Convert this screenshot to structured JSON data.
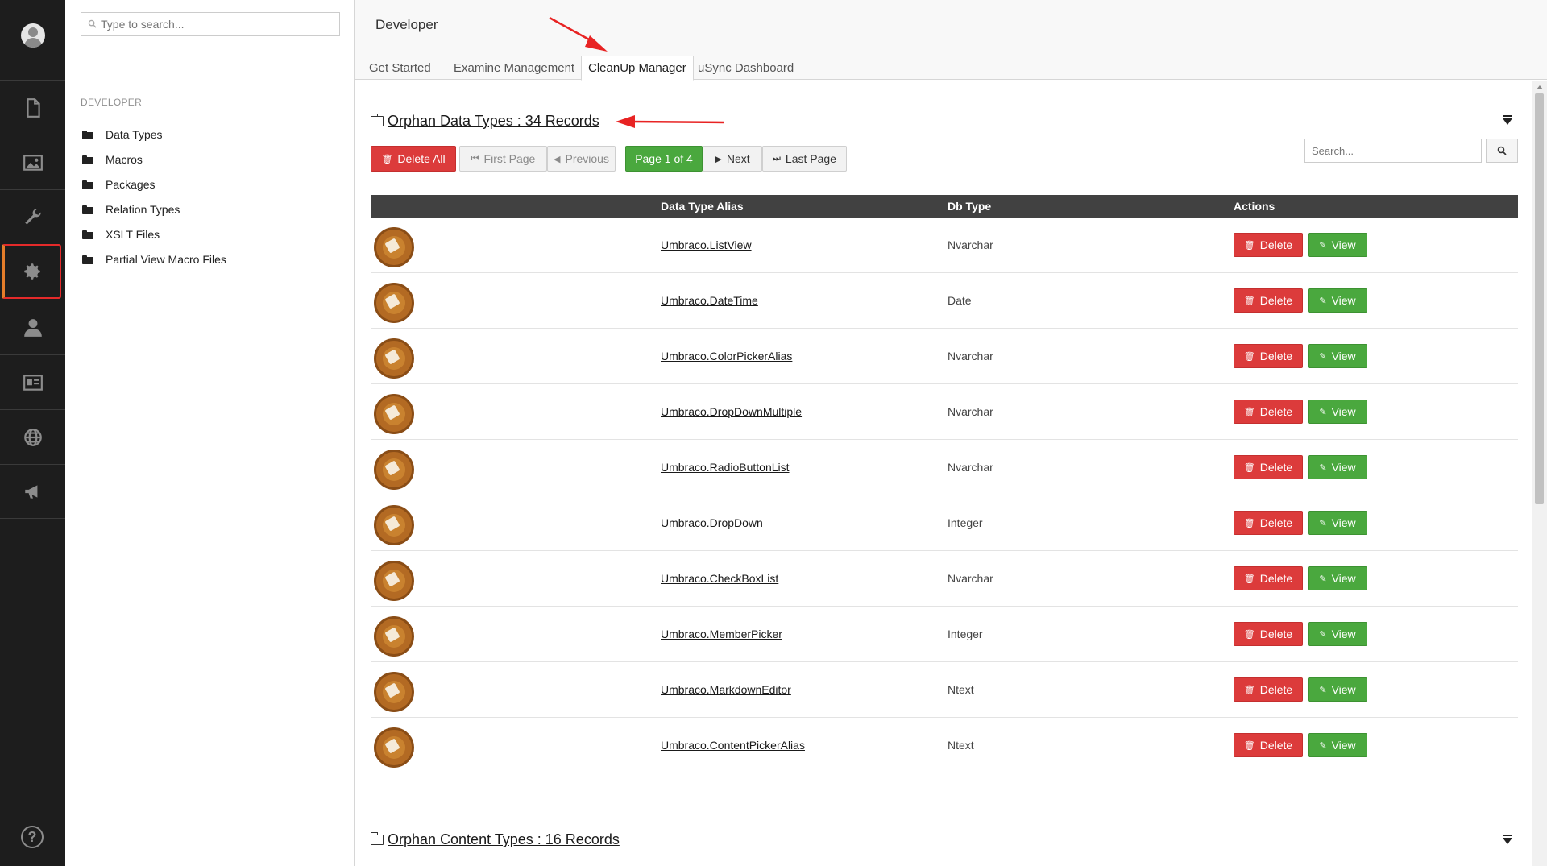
{
  "tree": {
    "search_placeholder": "Type to search...",
    "heading": "DEVELOPER",
    "items": [
      {
        "label": "Data Types"
      },
      {
        "label": "Macros"
      },
      {
        "label": "Packages"
      },
      {
        "label": "Relation Types"
      },
      {
        "label": "XSLT Files"
      },
      {
        "label": "Partial View Macro Files"
      }
    ]
  },
  "rail": {
    "icons": [
      "content-icon",
      "media-icon",
      "settings-wrench-icon",
      "developer-gear-icon",
      "users-icon",
      "members-icon",
      "translation-globe-icon",
      "forms-megaphone-icon"
    ],
    "active": "developer-gear-icon",
    "help": "?"
  },
  "header": {
    "title": "Developer",
    "tabs": [
      {
        "label": "Get Started",
        "active": false
      },
      {
        "label": "Examine Management",
        "active": false
      },
      {
        "label": "CleanUp Manager",
        "active": true
      },
      {
        "label": "uSync Dashboard",
        "active": false
      }
    ]
  },
  "orphan_data_types": {
    "title": "Orphan Data Types : 34 Records",
    "pager": {
      "delete_all": "Delete All",
      "first": "First Page",
      "previous": "Previous",
      "page": "Page 1 of 4",
      "next": "Next",
      "last": "Last Page"
    },
    "search_placeholder": "Search...",
    "columns": [
      "Data Type Alias",
      "Db Type",
      "Actions"
    ],
    "delete_label": "Delete",
    "view_label": "View",
    "rows": [
      {
        "alias": "Umbraco.ListView",
        "db_type": "Nvarchar"
      },
      {
        "alias": "Umbraco.DateTime",
        "db_type": "Date"
      },
      {
        "alias": "Umbraco.ColorPickerAlias",
        "db_type": "Nvarchar"
      },
      {
        "alias": "Umbraco.DropDownMultiple",
        "db_type": "Nvarchar"
      },
      {
        "alias": "Umbraco.RadioButtonList",
        "db_type": "Nvarchar"
      },
      {
        "alias": "Umbraco.DropDown",
        "db_type": "Integer"
      },
      {
        "alias": "Umbraco.CheckBoxList",
        "db_type": "Nvarchar"
      },
      {
        "alias": "Umbraco.MemberPicker",
        "db_type": "Integer"
      },
      {
        "alias": "Umbraco.MarkdownEditor",
        "db_type": "Ntext"
      },
      {
        "alias": "Umbraco.ContentPickerAlias",
        "db_type": "Ntext"
      }
    ]
  },
  "orphan_content_types": {
    "title": "Orphan Content Types : 16 Records"
  },
  "colors": {
    "rail_bg": "#1d1d1d",
    "delete": "#dc3b3b",
    "view": "#4aa83e",
    "table_header": "#414141",
    "annotation_arrow": "#e82323"
  }
}
